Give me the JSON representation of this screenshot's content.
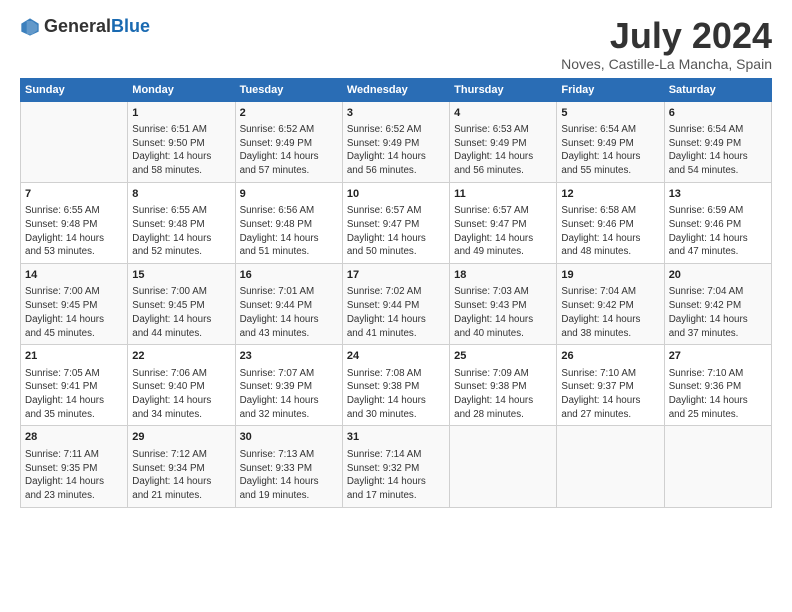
{
  "logo": {
    "general": "General",
    "blue": "Blue"
  },
  "title": "July 2024",
  "location": "Noves, Castille-La Mancha, Spain",
  "headers": [
    "Sunday",
    "Monday",
    "Tuesday",
    "Wednesday",
    "Thursday",
    "Friday",
    "Saturday"
  ],
  "weeks": [
    [
      {
        "day": "",
        "text": ""
      },
      {
        "day": "1",
        "text": "Sunrise: 6:51 AM\nSunset: 9:50 PM\nDaylight: 14 hours\nand 58 minutes."
      },
      {
        "day": "2",
        "text": "Sunrise: 6:52 AM\nSunset: 9:49 PM\nDaylight: 14 hours\nand 57 minutes."
      },
      {
        "day": "3",
        "text": "Sunrise: 6:52 AM\nSunset: 9:49 PM\nDaylight: 14 hours\nand 56 minutes."
      },
      {
        "day": "4",
        "text": "Sunrise: 6:53 AM\nSunset: 9:49 PM\nDaylight: 14 hours\nand 56 minutes."
      },
      {
        "day": "5",
        "text": "Sunrise: 6:54 AM\nSunset: 9:49 PM\nDaylight: 14 hours\nand 55 minutes."
      },
      {
        "day": "6",
        "text": "Sunrise: 6:54 AM\nSunset: 9:49 PM\nDaylight: 14 hours\nand 54 minutes."
      }
    ],
    [
      {
        "day": "7",
        "text": "Sunrise: 6:55 AM\nSunset: 9:48 PM\nDaylight: 14 hours\nand 53 minutes."
      },
      {
        "day": "8",
        "text": "Sunrise: 6:55 AM\nSunset: 9:48 PM\nDaylight: 14 hours\nand 52 minutes."
      },
      {
        "day": "9",
        "text": "Sunrise: 6:56 AM\nSunset: 9:48 PM\nDaylight: 14 hours\nand 51 minutes."
      },
      {
        "day": "10",
        "text": "Sunrise: 6:57 AM\nSunset: 9:47 PM\nDaylight: 14 hours\nand 50 minutes."
      },
      {
        "day": "11",
        "text": "Sunrise: 6:57 AM\nSunset: 9:47 PM\nDaylight: 14 hours\nand 49 minutes."
      },
      {
        "day": "12",
        "text": "Sunrise: 6:58 AM\nSunset: 9:46 PM\nDaylight: 14 hours\nand 48 minutes."
      },
      {
        "day": "13",
        "text": "Sunrise: 6:59 AM\nSunset: 9:46 PM\nDaylight: 14 hours\nand 47 minutes."
      }
    ],
    [
      {
        "day": "14",
        "text": "Sunrise: 7:00 AM\nSunset: 9:45 PM\nDaylight: 14 hours\nand 45 minutes."
      },
      {
        "day": "15",
        "text": "Sunrise: 7:00 AM\nSunset: 9:45 PM\nDaylight: 14 hours\nand 44 minutes."
      },
      {
        "day": "16",
        "text": "Sunrise: 7:01 AM\nSunset: 9:44 PM\nDaylight: 14 hours\nand 43 minutes."
      },
      {
        "day": "17",
        "text": "Sunrise: 7:02 AM\nSunset: 9:44 PM\nDaylight: 14 hours\nand 41 minutes."
      },
      {
        "day": "18",
        "text": "Sunrise: 7:03 AM\nSunset: 9:43 PM\nDaylight: 14 hours\nand 40 minutes."
      },
      {
        "day": "19",
        "text": "Sunrise: 7:04 AM\nSunset: 9:42 PM\nDaylight: 14 hours\nand 38 minutes."
      },
      {
        "day": "20",
        "text": "Sunrise: 7:04 AM\nSunset: 9:42 PM\nDaylight: 14 hours\nand 37 minutes."
      }
    ],
    [
      {
        "day": "21",
        "text": "Sunrise: 7:05 AM\nSunset: 9:41 PM\nDaylight: 14 hours\nand 35 minutes."
      },
      {
        "day": "22",
        "text": "Sunrise: 7:06 AM\nSunset: 9:40 PM\nDaylight: 14 hours\nand 34 minutes."
      },
      {
        "day": "23",
        "text": "Sunrise: 7:07 AM\nSunset: 9:39 PM\nDaylight: 14 hours\nand 32 minutes."
      },
      {
        "day": "24",
        "text": "Sunrise: 7:08 AM\nSunset: 9:38 PM\nDaylight: 14 hours\nand 30 minutes."
      },
      {
        "day": "25",
        "text": "Sunrise: 7:09 AM\nSunset: 9:38 PM\nDaylight: 14 hours\nand 28 minutes."
      },
      {
        "day": "26",
        "text": "Sunrise: 7:10 AM\nSunset: 9:37 PM\nDaylight: 14 hours\nand 27 minutes."
      },
      {
        "day": "27",
        "text": "Sunrise: 7:10 AM\nSunset: 9:36 PM\nDaylight: 14 hours\nand 25 minutes."
      }
    ],
    [
      {
        "day": "28",
        "text": "Sunrise: 7:11 AM\nSunset: 9:35 PM\nDaylight: 14 hours\nand 23 minutes."
      },
      {
        "day": "29",
        "text": "Sunrise: 7:12 AM\nSunset: 9:34 PM\nDaylight: 14 hours\nand 21 minutes."
      },
      {
        "day": "30",
        "text": "Sunrise: 7:13 AM\nSunset: 9:33 PM\nDaylight: 14 hours\nand 19 minutes."
      },
      {
        "day": "31",
        "text": "Sunrise: 7:14 AM\nSunset: 9:32 PM\nDaylight: 14 hours\nand 17 minutes."
      },
      {
        "day": "",
        "text": ""
      },
      {
        "day": "",
        "text": ""
      },
      {
        "day": "",
        "text": ""
      }
    ]
  ]
}
